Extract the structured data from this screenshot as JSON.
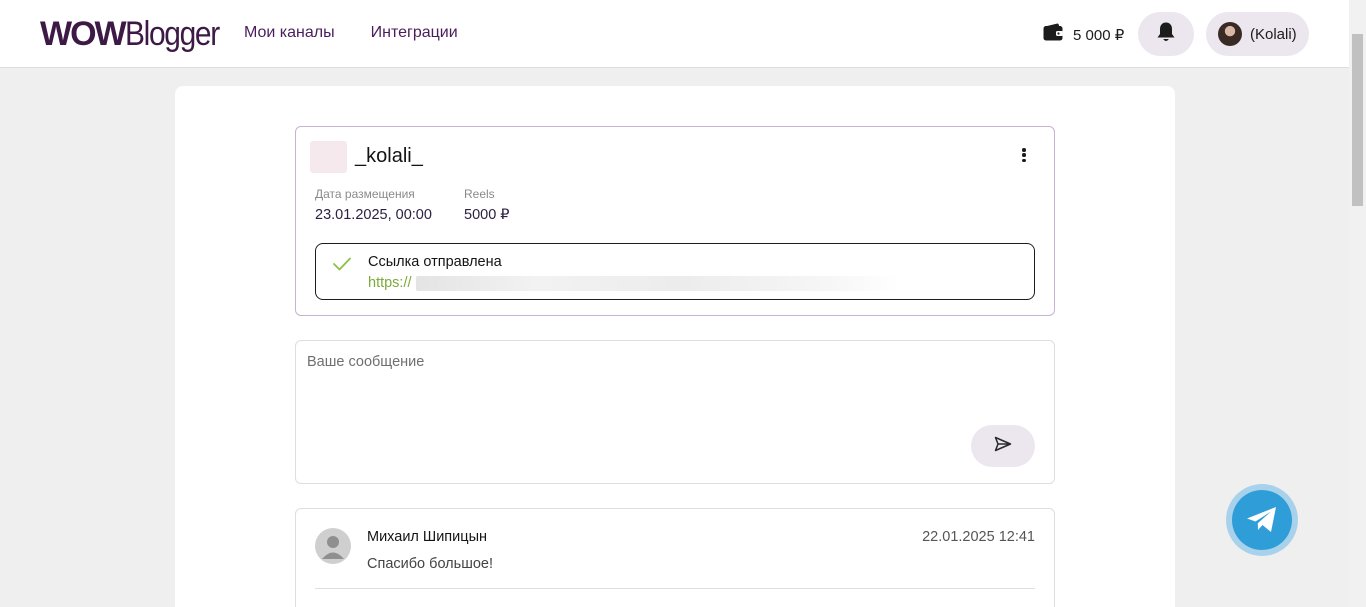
{
  "header": {
    "logo_wow": "WOW",
    "logo_blogger": "Blogger",
    "nav": [
      {
        "label": "Мои каналы"
      },
      {
        "label": "Интеграции"
      }
    ],
    "wallet_amount": "5 000 ₽",
    "user_name": "(Kolali)"
  },
  "card": {
    "channel_name": "_kolali_",
    "date_label": "Дата размещения",
    "date_value": "23.01.2025, 00:00",
    "format_label": "Reels",
    "format_value": "5000 ₽",
    "link_status": "Ссылка отправлена",
    "link_url": "https://",
    "status_color": "#7eaa3a"
  },
  "message": {
    "placeholder": "Ваше сообщение"
  },
  "comments": [
    {
      "author": "Михаил Шипицын",
      "date": "22.01.2025 12:41",
      "text": "Спасибо большое!"
    }
  ],
  "colors": {
    "brand": "#3d1a45",
    "accent_bg": "#ece6ee",
    "telegram": "#2f9ed8"
  }
}
